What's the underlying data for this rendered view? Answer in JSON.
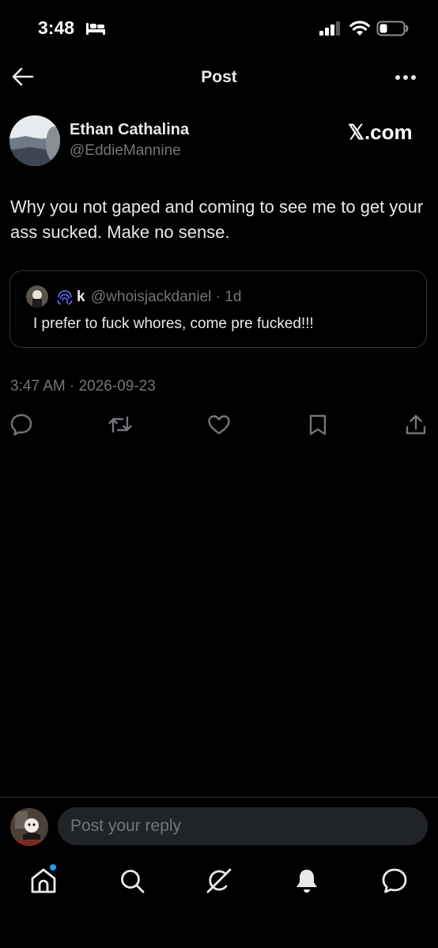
{
  "status_bar": {
    "time": "3:48"
  },
  "header": {
    "title": "Post"
  },
  "post": {
    "display_name": "Ethan Cathalina",
    "handle": "@EddieMannine",
    "watermark": "𝕏.com",
    "text": "Why you not gaped and coming to see me to get your ass sucked. Make no sense.",
    "timestamp": "3:47 AM · 2026-09-23"
  },
  "quote": {
    "name": "k",
    "handle_time": "@whoisjackdaniel · 1d",
    "text": "I prefer to fuck whores, come pre fucked!!!"
  },
  "reply": {
    "placeholder": "Post your reply"
  },
  "icons": {
    "actions": [
      "reply-icon",
      "repost-icon",
      "like-icon",
      "bookmark-icon",
      "share-icon"
    ],
    "bottom_nav": [
      "home-icon",
      "search-icon",
      "grok-icon",
      "notifications-icon",
      "messages-icon"
    ]
  },
  "colors": {
    "background": "#000000",
    "text": "#e7e9ea",
    "muted": "#71767b",
    "accent": "#1d9bf0",
    "border": "#2f3336"
  }
}
